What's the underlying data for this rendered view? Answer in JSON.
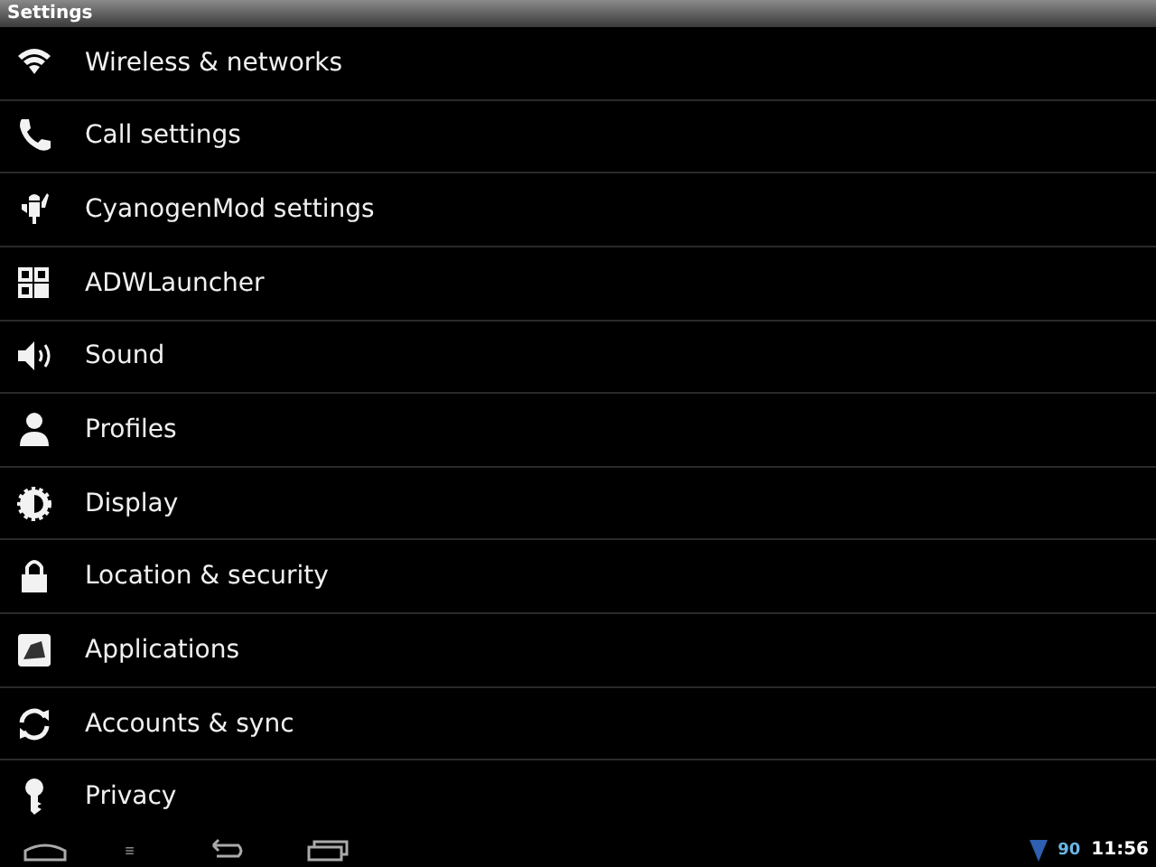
{
  "window": {
    "title": "Settings"
  },
  "items": [
    {
      "label": "Wireless & networks"
    },
    {
      "label": "Call settings"
    },
    {
      "label": "CyanogenMod settings"
    },
    {
      "label": "ADWLauncher"
    },
    {
      "label": "Sound"
    },
    {
      "label": "Profiles"
    },
    {
      "label": "Display"
    },
    {
      "label": "Location & security"
    },
    {
      "label": "Applications"
    },
    {
      "label": "Accounts & sync"
    },
    {
      "label": "Privacy"
    }
  ],
  "status_bar": {
    "battery": "90",
    "time": "11:56"
  }
}
